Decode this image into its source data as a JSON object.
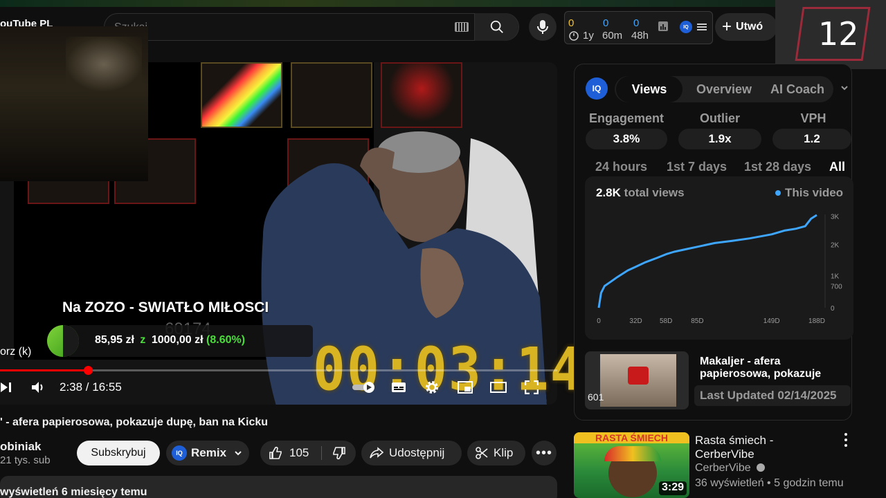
{
  "header": {
    "logo_text": "ouTube PL",
    "search_placeholder": "Szukaj",
    "create_label": "Utwó",
    "stats": [
      {
        "value": "0",
        "label": "1y",
        "color": "#f1c232"
      },
      {
        "value": "0",
        "label": "60m",
        "color": "#3ea6ff"
      },
      {
        "value": "0",
        "label": "48h",
        "color": "#3ea6ff"
      }
    ],
    "counter": "12"
  },
  "player": {
    "overlay_title": "Na ZOZO - SWIATŁO MIŁOSCI",
    "donation": {
      "current": "85,95 zł",
      "connector": "z",
      "goal": "1000,00 zł",
      "percent": "(8.60%)",
      "progress": 0.086
    },
    "side_tag": "orz (k)",
    "game_number": "60174",
    "stream_timer": "00:03:14",
    "time": "2:38 / 16:55",
    "progress": 0.158
  },
  "video": {
    "title": "' - afera papierosowa, pokazuje dupę, ban na Kicku",
    "channel_name": "obiniak",
    "channel_subs": "21 tys. sub",
    "subscribe_label": "Subskrybuj",
    "remix_label": "Remix",
    "likes": "105",
    "share_label": "Udostępnij",
    "clip_label": "Klip",
    "description_meta": "wyświetleń  6 miesięcy temu"
  },
  "panel": {
    "badge": "IQ",
    "tabs": [
      {
        "label": "Views",
        "active": true
      },
      {
        "label": "Overview",
        "active": false
      },
      {
        "label": "AI Coach",
        "active": false
      }
    ],
    "metrics": [
      {
        "label": "Engagement",
        "value": "3.8%"
      },
      {
        "label": "Outlier",
        "value": "1.9x"
      },
      {
        "label": "VPH",
        "value": "1.2"
      }
    ],
    "ranges": [
      {
        "label": "24 hours",
        "active": false
      },
      {
        "label": "1st 7 days",
        "active": false
      },
      {
        "label": "1st 28 days",
        "active": false
      },
      {
        "label": "All",
        "active": true
      }
    ],
    "total_views_value": "2.8K",
    "total_views_suffix": "total views",
    "legend_label": "This video",
    "related_title": "Makaljer - afera papierosowa, pokazuje dupę, ban na Kicku",
    "related_thumb_tag": "601",
    "last_updated": "Last Updated 02/14/2025"
  },
  "chart_data": {
    "type": "line",
    "x_ticks": [
      "0",
      "32D",
      "58D",
      "85D",
      "149D",
      "188D"
    ],
    "y_ticks": [
      "0",
      "700",
      "1K",
      "2K",
      "3K"
    ],
    "x": [
      0,
      2,
      5,
      10,
      15,
      20,
      25,
      32,
      40,
      50,
      58,
      65,
      75,
      85,
      100,
      115,
      130,
      149,
      160,
      170,
      178,
      183,
      188
    ],
    "series": [
      {
        "values": [
          0,
          480,
          700,
          830,
          960,
          1080,
          1200,
          1320,
          1460,
          1600,
          1720,
          1800,
          1880,
          1960,
          2080,
          2150,
          2230,
          2360,
          2480,
          2540,
          2620,
          2860,
          2980
        ]
      }
    ],
    "ylim": [
      0,
      3000
    ],
    "grid": false,
    "legend_position": "top-right",
    "color": "#3ea6ff"
  },
  "recommendation": {
    "thumb_title": "RASTA ŚMIECH",
    "duration": "3:29",
    "title": "Rasta śmiech - CerberVibe",
    "channel": "CerberVibe",
    "meta": "36 wyświetleń • 5 godzin temu"
  }
}
